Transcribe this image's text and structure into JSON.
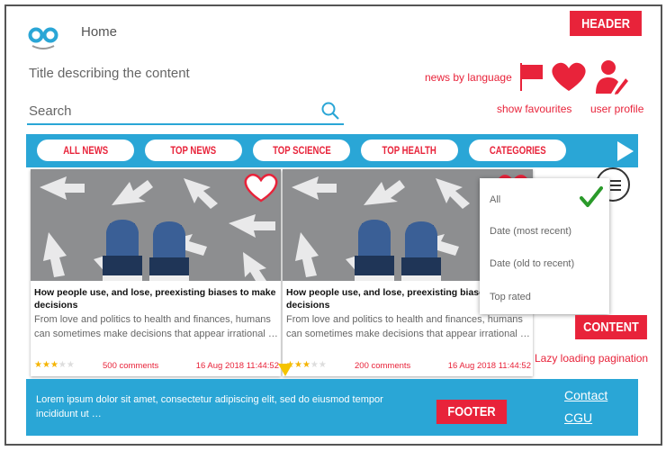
{
  "header": {
    "home_label": "Home",
    "title_description": "Title describing the content",
    "search_placeholder": "Search",
    "tag": "HEADER",
    "news_by_language": "news by language",
    "show_favourites": "show favourites",
    "user_profile": "user profile"
  },
  "nav": {
    "items": [
      {
        "label": "ALL NEWS"
      },
      {
        "label": "TOP NEWS"
      },
      {
        "label": "TOP SCIENCE"
      },
      {
        "label": "TOP HEALTH"
      },
      {
        "label": "CATEGORIES"
      }
    ]
  },
  "cards": [
    {
      "title": "How people use, and lose, preexisting biases to make decisions",
      "description": "From love and politics to health and finances, humans can sometimes make decisions that appear irrational …",
      "rating": 2.5,
      "comments": "500 comments",
      "date": "16 Aug 2018 11:44:52"
    },
    {
      "title": "How people use, and lose, preexisting biases to make decisions",
      "description": "From love and politics to health and finances, humans can sometimes make decisions that appear irrational …",
      "rating": 2.5,
      "comments": "200 comments",
      "date": "16 Aug 2018 11:44:52"
    }
  ],
  "sort_menu": {
    "items": [
      {
        "label": "All"
      },
      {
        "label": "Date (most recent)"
      },
      {
        "label": "Date (old to recent)"
      },
      {
        "label": "Top rated"
      }
    ],
    "selected": "All"
  },
  "content": {
    "tag": "CONTENT",
    "lazy_loading": "Lazy loading pagination"
  },
  "footer": {
    "text": "Lorem ipsum dolor sit amet, consectetur adipiscing elit, sed do eiusmod tempor incididunt ut …",
    "tag": "FOOTER",
    "contact": "Contact",
    "cgu": "CGU"
  },
  "colors": {
    "accent_blue": "#2aa6d6",
    "accent_red": "#e8233a",
    "star": "#f5b400"
  }
}
